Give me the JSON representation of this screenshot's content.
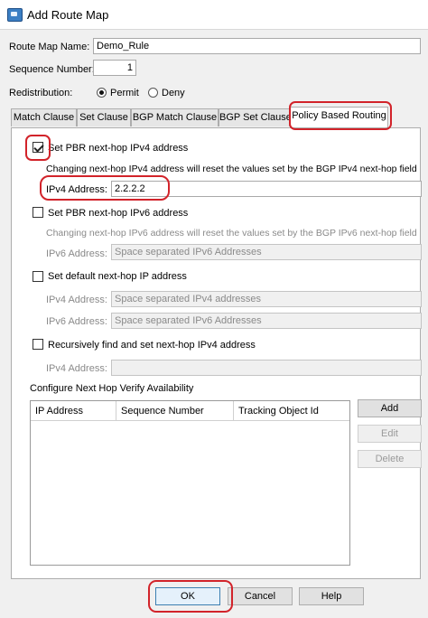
{
  "window": {
    "title": "Add Route Map",
    "icon": "route-map-app-icon"
  },
  "form": {
    "route_map_name_label": "Route Map Name:",
    "route_map_name_value": "Demo_Rule",
    "sequence_number_label": "Sequence Number:",
    "sequence_number_value": "1",
    "redistribution_label": "Redistribution:",
    "permit_label": "Permit",
    "deny_label": "Deny",
    "redistribution_selected": "Permit"
  },
  "tabs": [
    {
      "label": "Match Clause"
    },
    {
      "label": "Set Clause"
    },
    {
      "label": "BGP Match Clause"
    },
    {
      "label": "BGP Set Clause"
    },
    {
      "label": "Policy Based Routing",
      "active": true
    }
  ],
  "pbr": {
    "ipv4_nexthop_check_label": "Set PBR next-hop IPv4 address",
    "ipv4_nexthop_checked": true,
    "ipv4_note": "Changing next-hop IPv4 address will reset the values set by the BGP IPv4 next-hop field",
    "ipv4_address_label": "IPv4 Address:",
    "ipv4_address_value": "2.2.2.2",
    "ipv6_nexthop_check_label": "Set PBR next-hop IPv6 address",
    "ipv6_note": "Changing next-hop IPv6 address will reset the values set by the BGP IPv6 next-hop field",
    "ipv6_address_label": "IPv6 Address:",
    "ipv6_address_placeholder": "Space separated IPv6 Addresses",
    "default_nexthop_check_label": "Set default next-hop IP address",
    "default_ipv4_label": "IPv4 Address:",
    "default_ipv4_placeholder": "Space separated IPv4 addresses",
    "default_ipv6_label": "IPv6 Address:",
    "default_ipv6_placeholder": "Space separated IPv6 Addresses",
    "recursive_check_label": "Recursively find and set next-hop IPv4 address",
    "recursive_ipv4_label": "IPv4 Address:",
    "verify_group_label": "Configure Next Hop Verify Availability",
    "table_headers": [
      "IP Address",
      "Sequence Number",
      "Tracking Object Id"
    ],
    "add_label": "Add",
    "edit_label": "Edit",
    "delete_label": "Delete"
  },
  "footer": {
    "ok_label": "OK",
    "cancel_label": "Cancel",
    "help_label": "Help"
  },
  "colors": {
    "highlight": "#d2232a",
    "accent": "#3c7fb1"
  }
}
